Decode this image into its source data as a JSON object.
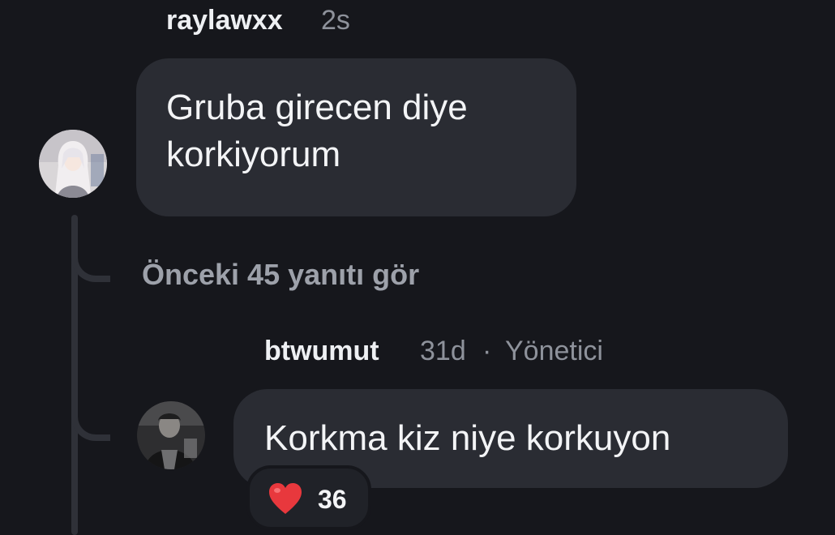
{
  "comments": [
    {
      "username": "raylawxx",
      "time": "2s",
      "role": "",
      "text_lines": [
        "Gruba girecen diye",
        "korkiyorum"
      ]
    },
    {
      "username": "btwumut",
      "time": "31d",
      "separator": "·",
      "role": "Yönetici",
      "text_lines": [
        "Korkma kiz niye korkuyon"
      ],
      "reaction": {
        "emoji": "❤️",
        "icon": "heart-icon",
        "count": "36"
      }
    }
  ],
  "thread": {
    "view_previous_label": "Önceki 45 yanıtı gör"
  },
  "colors": {
    "background": "#16171c",
    "bubble": "#2a2c33",
    "thread_line": "#2f3138",
    "muted_text": "#8e929b",
    "heart": "#e8383d"
  }
}
